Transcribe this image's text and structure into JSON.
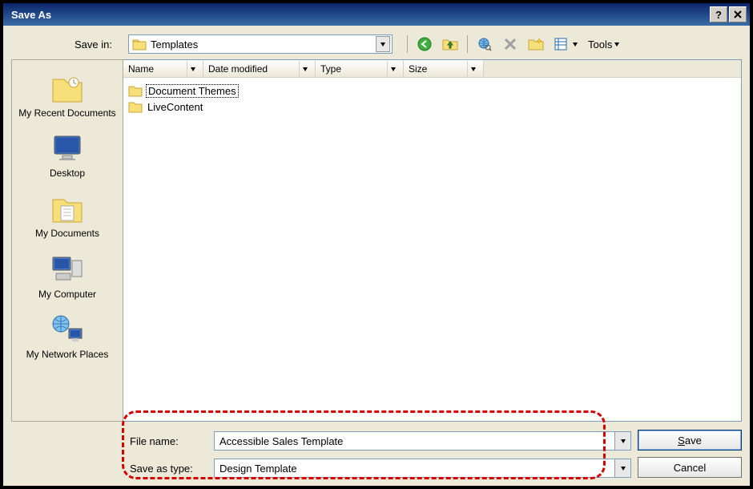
{
  "window": {
    "title": "Save As"
  },
  "toprow": {
    "save_in_label": "Save in:",
    "save_in_value": "Templates",
    "tools_label": "Tools"
  },
  "columns": {
    "name": "Name",
    "date": "Date modified",
    "type": "Type",
    "size": "Size"
  },
  "places": [
    {
      "label": "My Recent Documents"
    },
    {
      "label": "Desktop"
    },
    {
      "label": "My Documents"
    },
    {
      "label": "My Computer"
    },
    {
      "label": "My Network Places"
    }
  ],
  "files": [
    {
      "name": "Document Themes",
      "focused": true
    },
    {
      "name": "LiveContent",
      "focused": false
    }
  ],
  "fields": {
    "filename_label": "File name:",
    "filename_value": "Accessible Sales Template",
    "savetype_label": "Save as type:",
    "savetype_value": "Design Template"
  },
  "buttons": {
    "save": "Save",
    "cancel": "Cancel"
  }
}
